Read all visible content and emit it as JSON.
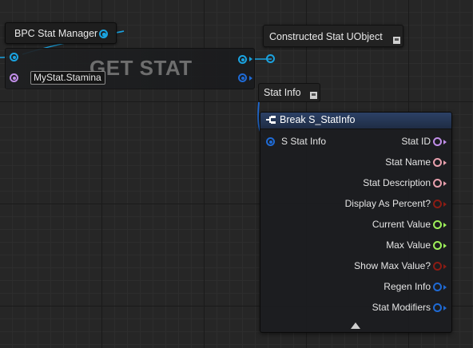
{
  "graph": {
    "stat_manager_node": {
      "label": "BPC Stat Manager"
    },
    "get_stat_node": {
      "title": "GET STAT",
      "stat_tag_value": "MyStat.Stamina"
    },
    "constructed_node": {
      "label": "Constructed Stat UObject"
    },
    "stat_info_node": {
      "label": "Stat Info"
    },
    "break_node": {
      "title": "Break S_StatInfo",
      "input_label": "S Stat Info",
      "outputs": [
        {
          "label": "Stat ID",
          "color": "#c08ee8"
        },
        {
          "label": "Stat Name",
          "color": "#e8a0ad"
        },
        {
          "label": "Stat Description",
          "color": "#e8a0ad"
        },
        {
          "label": "Display As Percent?",
          "color": "#8c1c14"
        },
        {
          "label": "Current Value",
          "color": "#9ef05a"
        },
        {
          "label": "Max Value",
          "color": "#9ef05a"
        },
        {
          "label": "Show Max Value?",
          "color": "#8c1c14"
        },
        {
          "label": "Regen Info",
          "color": "#1f6ad4"
        },
        {
          "label": "Stat Modifiers",
          "color": "#1f6ad4"
        }
      ]
    },
    "colors": {
      "object_pin": "#1aa3e0",
      "struct_pin": "#1f6ad4",
      "tag_pin": "#c08ee8",
      "header": "#2c4166"
    }
  }
}
